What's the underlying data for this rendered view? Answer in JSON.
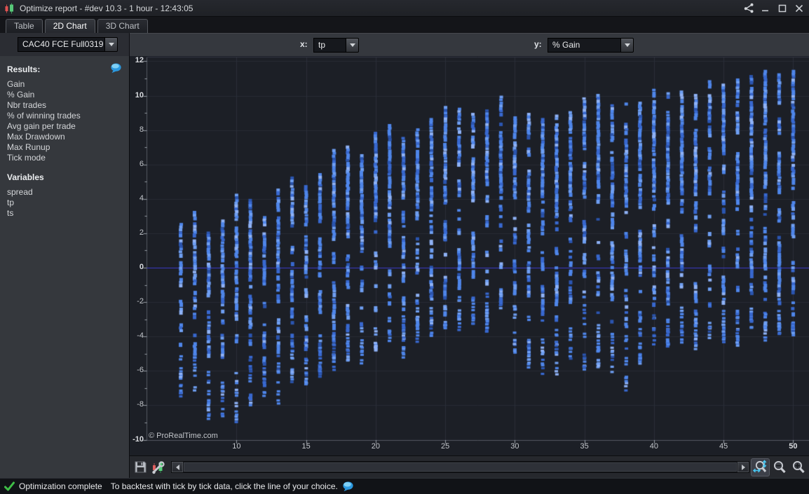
{
  "window": {
    "title": "Optimize report - #dev 10.3 - 1 hour - 12:43:05"
  },
  "tabs": [
    {
      "label": "Table",
      "active": false
    },
    {
      "label": "2D Chart",
      "active": true
    },
    {
      "label": "3D Chart",
      "active": false
    }
  ],
  "instrument": {
    "value": "CAC40 FCE Full0319"
  },
  "axis_selectors": {
    "x_label": "x:",
    "x_value": "tp",
    "y_label": "y:",
    "y_value": "% Gain"
  },
  "sidebar": {
    "results_header": "Results:",
    "results": [
      "Gain",
      "% Gain",
      "Nbr trades",
      "% of winning trades",
      "Avg gain per trade",
      "Max Drawdown",
      "Max Runup",
      "Tick mode"
    ],
    "variables_header": "Variables",
    "variables": [
      "spread",
      "tp",
      "ts"
    ]
  },
  "chart_data": {
    "type": "scatter",
    "xlabel": "tp",
    "ylabel": "% Gain",
    "xlim": [
      5.5,
      51
    ],
    "ylim": [
      -10,
      12
    ],
    "x_ticks": [
      10,
      15,
      20,
      25,
      30,
      35,
      40,
      45,
      50
    ],
    "x_ticks_bold": [
      50
    ],
    "y_ticks": [
      12,
      10,
      8,
      6,
      4,
      2,
      0,
      -2,
      -4,
      -6,
      -8,
      -10
    ],
    "y_ticks_bold": [
      12,
      10,
      0,
      -10
    ],
    "grid": true,
    "zero_line": 0,
    "watermark": "© ProRealTime.com",
    "point_colors": [
      "#4f86ea",
      "#6f9ff2",
      "#8fb2f6",
      "#3868cf",
      "#2b55b0"
    ],
    "zero_line_color": "#3c3ccd",
    "columns_note": "each column = vertical strip of optimization results at integer tp; top = max % gain, dense_bottom = end of dense cluster, min = lowest sparse outlier",
    "columns": [
      {
        "x": 6,
        "top": 2.6,
        "dense_bottom": -4.6,
        "min": -7.6
      },
      {
        "x": 7,
        "top": 3.3,
        "dense_bottom": -4.9,
        "min": -6.9
      },
      {
        "x": 8,
        "top": 2.1,
        "dense_bottom": -5.6,
        "min": -9.0
      },
      {
        "x": 9,
        "top": 2.8,
        "dense_bottom": -5.3,
        "min": -8.9
      },
      {
        "x": 10,
        "top": 4.3,
        "dense_bottom": -5.1,
        "min": -9.2
      },
      {
        "x": 11,
        "top": 4.0,
        "dense_bottom": -5.4,
        "min": -8.1
      },
      {
        "x": 12,
        "top": 3.0,
        "dense_bottom": -5.6,
        "min": -7.3
      },
      {
        "x": 13,
        "top": 4.6,
        "dense_bottom": -4.9,
        "min": -7.8
      },
      {
        "x": 14,
        "top": 5.3,
        "dense_bottom": -4.6,
        "min": -6.6
      },
      {
        "x": 15,
        "top": 4.8,
        "dense_bottom": -5.0,
        "min": -6.7
      },
      {
        "x": 16,
        "top": 5.5,
        "dense_bottom": -4.4,
        "min": -6.1
      },
      {
        "x": 17,
        "top": 6.9,
        "dense_bottom": -4.1,
        "min": -5.9
      },
      {
        "x": 18,
        "top": 7.1,
        "dense_bottom": -3.7,
        "min": -5.3
      },
      {
        "x": 19,
        "top": 6.6,
        "dense_bottom": -3.3,
        "min": -5.6
      },
      {
        "x": 20,
        "top": 7.9,
        "dense_bottom": -3.0,
        "min": -4.7
      },
      {
        "x": 21,
        "top": 8.5,
        "dense_bottom": -2.6,
        "min": -4.4
      },
      {
        "x": 22,
        "top": 7.6,
        "dense_bottom": -2.4,
        "min": -5.1
      },
      {
        "x": 23,
        "top": 8.1,
        "dense_bottom": -2.2,
        "min": -4.2
      },
      {
        "x": 24,
        "top": 8.7,
        "dense_bottom": -2.0,
        "min": -4.0
      },
      {
        "x": 25,
        "top": 9.4,
        "dense_bottom": -1.8,
        "min": -3.6
      },
      {
        "x": 26,
        "top": 9.3,
        "dense_bottom": -1.5,
        "min": -3.4
      },
      {
        "x": 27,
        "top": 9.0,
        "dense_bottom": -1.7,
        "min": -3.2
      },
      {
        "x": 28,
        "top": 9.2,
        "dense_bottom": -1.3,
        "min": -3.5
      },
      {
        "x": 29,
        "top": 10.0,
        "dense_bottom": -1.1,
        "min": -3.1
      },
      {
        "x": 30,
        "top": 8.8,
        "dense_bottom": -1.6,
        "min": -5.0
      },
      {
        "x": 31,
        "top": 9.0,
        "dense_bottom": -2.2,
        "min": -5.7
      },
      {
        "x": 32,
        "top": 8.7,
        "dense_bottom": -2.7,
        "min": -6.2
      },
      {
        "x": 33,
        "top": 8.9,
        "dense_bottom": -3.0,
        "min": -6.0
      },
      {
        "x": 34,
        "top": 9.1,
        "dense_bottom": -2.4,
        "min": -5.4
      },
      {
        "x": 35,
        "top": 9.9,
        "dense_bottom": -2.2,
        "min": -5.8
      },
      {
        "x": 36,
        "top": 10.1,
        "dense_bottom": -2.7,
        "min": -5.7
      },
      {
        "x": 37,
        "top": 9.5,
        "dense_bottom": -3.2,
        "min": -6.7
      },
      {
        "x": 38,
        "top": 9.6,
        "dense_bottom": -3.7,
        "min": -7.2
      },
      {
        "x": 39,
        "top": 9.8,
        "dense_bottom": -3.0,
        "min": -5.7
      },
      {
        "x": 40,
        "top": 10.4,
        "dense_bottom": -2.7,
        "min": -4.7
      },
      {
        "x": 41,
        "top": 10.2,
        "dense_bottom": -2.8,
        "min": -4.4
      },
      {
        "x": 42,
        "top": 10.3,
        "dense_bottom": -2.2,
        "min": -4.2
      },
      {
        "x": 43,
        "top": 10.1,
        "dense_bottom": -2.6,
        "min": -4.5
      },
      {
        "x": 44,
        "top": 10.9,
        "dense_bottom": -2.0,
        "min": -4.0
      },
      {
        "x": 45,
        "top": 10.7,
        "dense_bottom": -2.4,
        "min": -4.2
      },
      {
        "x": 46,
        "top": 11.0,
        "dense_bottom": -2.7,
        "min": -4.4
      },
      {
        "x": 47,
        "top": 11.2,
        "dense_bottom": -2.2,
        "min": -3.7
      },
      {
        "x": 48,
        "top": 11.5,
        "dense_bottom": -2.5,
        "min": -4.0
      },
      {
        "x": 49,
        "top": 11.3,
        "dense_bottom": -2.3,
        "min": -3.8
      },
      {
        "x": 50,
        "top": 11.5,
        "dense_bottom": -2.6,
        "min": -4.1
      }
    ]
  },
  "statusbar": {
    "status": "Optimization complete",
    "message": "To backtest with tick by tick data, click the line of your choice."
  },
  "colors": {
    "accent_blue": "#4f86ea",
    "zero_line": "#3c3ccd",
    "status_check_green": "#3fbf47",
    "bubble_blue": "#37a3e8",
    "chart_bg": "#1c1f26",
    "sidebar_bg": "#35383d"
  }
}
